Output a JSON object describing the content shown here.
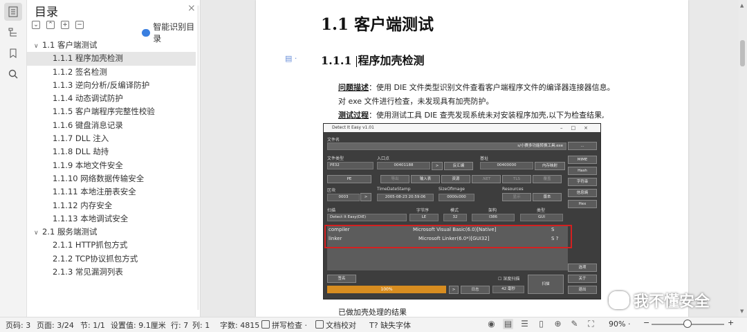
{
  "toc": {
    "title": "目录",
    "close": "×",
    "smart_label": "智能识别目录",
    "items": [
      {
        "label": "1.1 客户端测试",
        "level": 1,
        "caret": "∨"
      },
      {
        "label": "1.1.1 程序加壳检测",
        "level": 2,
        "selected": true
      },
      {
        "label": "1.1.2 签名检测",
        "level": 2
      },
      {
        "label": "1.1.3 逆向分析/反编译防护",
        "level": 2
      },
      {
        "label": "1.1.4 动态调试防护",
        "level": 2
      },
      {
        "label": "1.1.5 客户端程序完整性校验",
        "level": 2
      },
      {
        "label": "1.1.6 键盘消息记录",
        "level": 2
      },
      {
        "label": "1.1.7 DLL 注入",
        "level": 2
      },
      {
        "label": "1.1.8 DLL 劫持",
        "level": 2
      },
      {
        "label": "1.1.9 本地文件安全",
        "level": 2
      },
      {
        "label": "1.1.10 网络数据传输安全",
        "level": 2
      },
      {
        "label": "1.1.11 本地注册表安全",
        "level": 2
      },
      {
        "label": "1.1.12 内存安全",
        "level": 2
      },
      {
        "label": "1.1.13 本地调试安全",
        "level": 2
      },
      {
        "label": "2.1 服务端测试",
        "level": 1,
        "caret": "∨"
      },
      {
        "label": "2.1.1 HTTP抓包方式",
        "level": 2
      },
      {
        "label": "2.1.2 TCP协议抓包方式",
        "level": 2
      },
      {
        "label": "2.1.3 常见漏洞列表",
        "level": 2
      }
    ]
  },
  "doc": {
    "h1": "1.1  客户端测试",
    "h2_num": "1.1.1",
    "h2_text": "程序加壳检测",
    "p1_label": "问题描述",
    "p1_text": "：使用 DIE 文件类型识别文件查看客户端程序文件的编译器连接器信息。",
    "p2_text": "对 exe 文件进行检查，未发现具有加壳防护。",
    "p3_label": "测试过程",
    "p3_text": "：使用测试工具 DIE 查壳发现系统未对安装程序加壳,以下为检查结果,",
    "caption": "已做加壳处理的结果"
  },
  "die": {
    "title": "Detect It Easy v1.01",
    "file_label": "文件名",
    "file_value": "s/小赛多功能转换工具.exe",
    "browse": "...",
    "filetype_label": "文件类型",
    "filetype_value": "PE32",
    "entry_label": "入口点",
    "entry_value": "00401188",
    "disasm": "反汇编",
    "base_label": "基址",
    "base_value": "00400000",
    "memmap": "内存映射",
    "mime": "MIME",
    "hash": "Hash",
    "strings": "字符串",
    "entropy": "信息熵",
    "hex": "Hex",
    "pe": "PE",
    "export": "导出",
    "import": "输入表",
    "resource": "资源",
    "net": ".NET",
    "tls": "TLS",
    "overlay": "覆盖",
    "section_label": "区块",
    "section_value": "0003",
    "timestamp_label": "TimeDateStamp",
    "timestamp_value": "2005-08-23 20:59:06",
    "sizeofimage_label": "SizeOfImage",
    "sizeofimage_value": "0000c000",
    "resources_label": "Resources",
    "show": "显示",
    "version": "版本",
    "scan_label": "扫描",
    "endian_label": "字节序",
    "mode_label": "模式",
    "arch_label": "架构",
    "type_label": "类型",
    "scan_value": "Detect It Easy(DiE)",
    "endian_value": "LE",
    "mode_value": "32",
    "arch_value": "I386",
    "type_value": "GUI",
    "rows": [
      {
        "k": "compiler",
        "v": "Microsoft Visual Basic(6.0)[Native]",
        "f": "S"
      },
      {
        "k": "linker",
        "v": "Microsoft Linker(6.0*)[GUI32]",
        "f": "S  ?"
      }
    ],
    "options": "选项",
    "about": "关于",
    "exit": "退出",
    "signatures": "签名",
    "deep_scan": "深度扫描",
    "scan_btn": "扫描",
    "progress": "100%",
    "log": "日志",
    "time": "42 毫秒"
  },
  "watermark": "我不懂安全",
  "status": {
    "page_code": "页码: 3",
    "page": "页面: 3/24",
    "section": "节: 1/1",
    "setting": "设置值: 9.1厘米",
    "row": "行: 7",
    "col": "列: 1",
    "words": "字数: 4815",
    "spell": "拼写检查 ·",
    "proof": "文档校对",
    "missing_font": "缺失字体",
    "zoom": "90% ·",
    "minus": "−",
    "plus": "+"
  }
}
